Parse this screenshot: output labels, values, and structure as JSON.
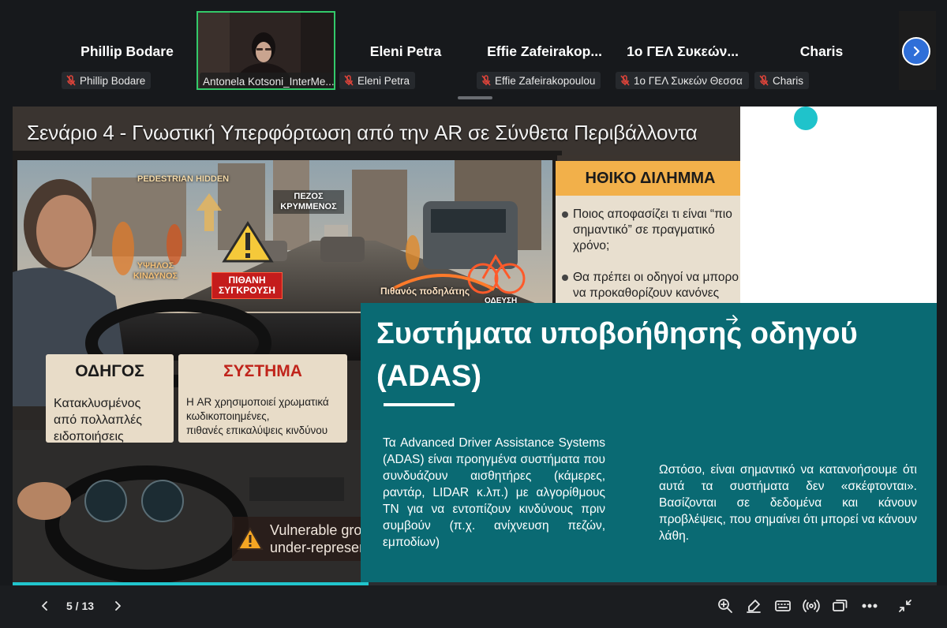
{
  "participants": [
    {
      "display_name": "Phillip Bodare",
      "tag": "Phillip Bodare",
      "muted": true
    },
    {
      "display_name": "",
      "tag": "Antonela Kotsoni_InterMe...",
      "muted": false,
      "video": true
    },
    {
      "display_name": "Eleni Petra",
      "tag": "Eleni Petra",
      "muted": true
    },
    {
      "display_name": "Effie  Zafeirakop...",
      "tag": "Effie Zafeirakopoulou",
      "muted": true
    },
    {
      "display_name": "1ο ΓΕΛ Συκεών...",
      "tag": "1ο ΓΕΛ Συκεών Θεσσα",
      "muted": true
    },
    {
      "display_name": "Charis",
      "tag": "Charis",
      "muted": true
    }
  ],
  "slide": {
    "scene_title": "Σενάριο 4 - Γνωστική Υπερφόρτωση από την AR σε Σύνθετα Περιβάλλοντα",
    "hud": {
      "pedestrian_hidden": "PEDESTRIAN HIDDEN",
      "pezos_krymmenos": "ΠΕΖΟΣ ΚΡΥΜΜΕΝΟΣ",
      "ypsilos_kindynos": "ΥΨΗΛΟΣ ΚΙΝΔΥΝΟΣ",
      "pithani_sygkrousi": "ΠΙΘΑΝΗ ΣΥΓΚΡΟΥΣΗ",
      "pithanos_podilatis": "Πιθανός ποδηλάτης",
      "odefsi": "ΟΔΕΥΣΗ"
    },
    "ethics": {
      "title": "ΗΘΙΚΟ ΔΙΛΗΜΜΑ",
      "bullet1_l1": "Ποιος αποφασίζει τι είναι “πιο",
      "bullet1_l2": "σημαντικό” σε πραγματικό",
      "bullet1_l3": "χρόνο;",
      "bullet2_l1": "Θα πρέπει οι οδηγοί να μπορο",
      "bullet2_l2": "να προκαθορίζουν κανόνες"
    },
    "driver_box": {
      "title": "ΟΔΗΓΟΣ",
      "l1": "Κατακλυσμένος",
      "l2": "από πολλαπλές",
      "l3": "ειδοποιήσεις"
    },
    "system_box": {
      "title": "ΣΥΣΤΗΜΑ",
      "l1": "Η AR χρησιμοποιεί χρωματικά",
      "l2": "κωδικοποιημένες,",
      "l3": "πιθανές επικαλύψεις κινδύνου"
    },
    "warning": {
      "l1": "Vulnerable gro",
      "l2": "under-represen"
    },
    "adas": {
      "title": "Συστήματα υποβοήθησης οδηγού (ADAS)",
      "left_text": "Τα Advanced Driver Assistance Systems (ADAS) είναι προηγμένα συστήματα που συνδυάζουν αισθητήρες (κάμερες, ραντάρ, LIDAR κ.λπ.) με αλγορίθμους ΤΝ για να εντοπίζουν κινδύνους πριν συμβούν (π.χ. ανίχνευση πεζών, εμποδίων)",
      "right_text": "Ωστόσο, είναι σημαντικό να κατανοήσουμε ότι αυτά τα συστήματα δεν «σκέφτονται». Βασίζονται σε δεδομένα και κάνουν προβλέψεις, που σημαίνει ότι μπορεί να κάνουν λάθη."
    }
  },
  "presentation": {
    "page_indicator": "5 / 13",
    "progress_fraction": 0.385
  },
  "colors": {
    "teal": "#0a6a73",
    "accent_cyan": "#21c5cd",
    "speaker_border": "#33c96a",
    "next_button": "#2f6fd8",
    "mute_red": "#e0443a"
  },
  "icons": {
    "prev": "chevron-left-icon",
    "next_page": "chevron-right-icon",
    "strip_next": "chevron-right-icon",
    "toolbar": [
      "zoom-in-icon",
      "annotate-pen-icon",
      "keyboard-icon",
      "broadcast-icon",
      "copy-screen-icon",
      "more-icon",
      "exit-fullscreen-icon"
    ]
  }
}
